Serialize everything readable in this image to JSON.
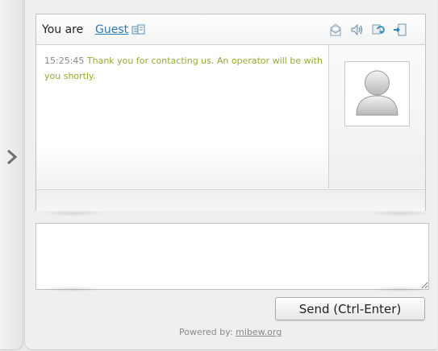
{
  "header": {
    "you_are_label": "You are",
    "user_name": "Guest",
    "icons": [
      "mail-icon",
      "sound-icon",
      "refresh-icon",
      "close-chat-icon"
    ]
  },
  "messages": [
    {
      "time": "15:25:45",
      "text": "Thank you for contacting us. An operator will be with you shortly."
    }
  ],
  "input": {
    "value": ""
  },
  "send": {
    "label": "Send (Ctrl-Enter)"
  },
  "footer": {
    "powered_prefix": "Powered by:",
    "powered_link": "mibew.org"
  },
  "colors": {
    "message_text": "#8fae33",
    "link": "#2a7ab8"
  }
}
